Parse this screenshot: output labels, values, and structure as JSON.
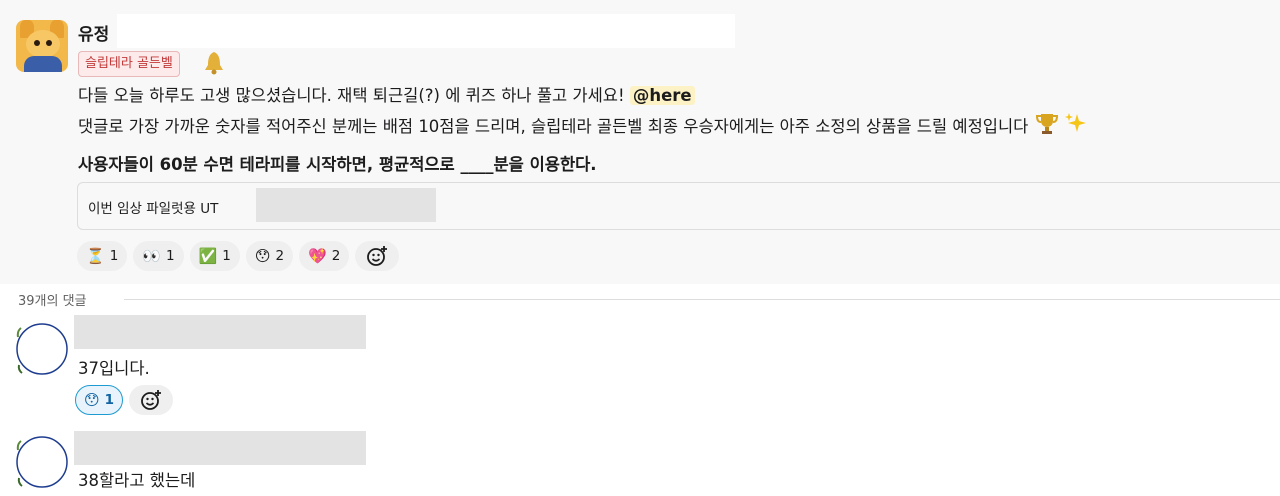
{
  "message": {
    "author": "유정",
    "badge": "슬립테라 골든벨",
    "line1_text": "다들 오늘 하루도 고생 많으셨습니다. 재택 퇴근길(?) 에 퀴즈 하나 풀고 가세요!",
    "mention": "@here",
    "line2_text": "댓글로 가장 가까운 숫자를 적어주신 분께는 배점 10점을 드리며, 슬립테라 골든벨 최종 우승자에게는 아주 소정의 상품을 드릴 예정입니다",
    "question": "사용자들이 60분 수면 테라피를 시작하면, 평균적으로 ____분을 이용한다.",
    "quote_text": "이번 임상 파일럿용 UT",
    "reactions": [
      {
        "emoji": "⏳",
        "count": "1"
      },
      {
        "emoji": "👀",
        "count": "1"
      },
      {
        "emoji": "✅",
        "count": "1"
      },
      {
        "emoji": "😯",
        "count": "2"
      },
      {
        "emoji": "💖",
        "count": "2"
      }
    ]
  },
  "thread": {
    "reply_count_label": "39개의 댓글",
    "replies": [
      {
        "text": "37입니다.",
        "reactions": [
          {
            "emoji": "😯",
            "count": "1"
          }
        ]
      },
      {
        "text": "38할라고 했는데"
      }
    ]
  },
  "icons": {
    "author_avatar": "bear-avatar-icon",
    "badge_icon": "bell-icon",
    "trophy": "trophy-icon",
    "sparkles": "sparkles-icon",
    "add_reaction": "add-reaction-icon"
  },
  "colors": {
    "mention_bg": "#fdf2c6",
    "badge_text": "#c23a3a",
    "active_reaction_border": "#1d9bd1"
  }
}
